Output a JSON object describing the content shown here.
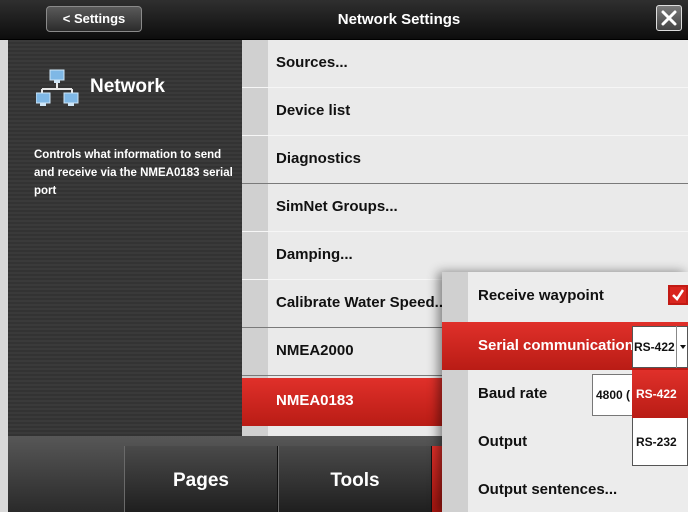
{
  "header": {
    "back_label": "< Settings",
    "title": "Network Settings"
  },
  "info": {
    "icon": "network-icon",
    "title": "Network",
    "description": "Controls what information to send and receive via the NMEA0183 serial port"
  },
  "menu": {
    "items": [
      {
        "label": "Sources..."
      },
      {
        "label": "Device list"
      },
      {
        "label": "Diagnostics"
      },
      {
        "label": "SimNet Groups..."
      },
      {
        "label": "Damping..."
      },
      {
        "label": "Calibrate Water Speed..."
      },
      {
        "label": "NMEA2000"
      },
      {
        "label": "NMEA0183"
      }
    ],
    "selected": "NMEA0183"
  },
  "bottom": {
    "tabs": [
      {
        "label": "Pages"
      },
      {
        "label": "Tools"
      }
    ]
  },
  "popup": {
    "receive_waypoint": {
      "label": "Receive waypoint",
      "checked": true
    },
    "serial_communication": {
      "label": "Serial communication",
      "value": "RS-422"
    },
    "baud_rate": {
      "label": "Baud rate",
      "value": "4800 ("
    },
    "output": {
      "label": "Output"
    },
    "output_sentences": {
      "label": "Output sentences..."
    },
    "dropdown_options": [
      "RS-422",
      "RS-232"
    ],
    "dropdown_selected": "RS-422"
  },
  "colors": {
    "accent_red": "#d9261f",
    "dark_panel": "#363636"
  }
}
